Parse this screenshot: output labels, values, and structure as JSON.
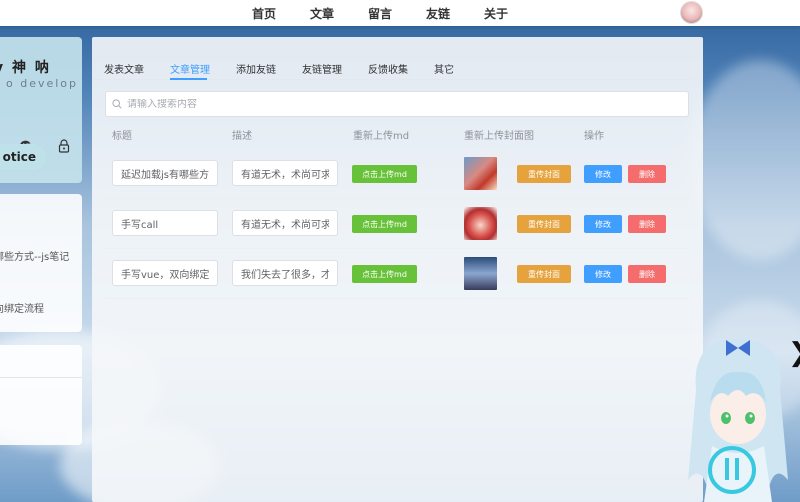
{
  "nav": {
    "links": [
      "首页",
      "文章",
      "留言",
      "友链",
      "关于"
    ]
  },
  "sidebar": {
    "name": "y 神 呐",
    "sub": "o develop",
    "notice": "otice",
    "recent": [
      "哪些方式--js笔记",
      "向绑定流程"
    ]
  },
  "tabs": [
    {
      "label": "发表文章",
      "active": false
    },
    {
      "label": "文章管理",
      "active": true
    },
    {
      "label": "添加友链",
      "active": false
    },
    {
      "label": "友链管理",
      "active": false
    },
    {
      "label": "反馈收集",
      "active": false
    },
    {
      "label": "其它",
      "active": false
    }
  ],
  "search": {
    "placeholder": "请输入搜索内容"
  },
  "table": {
    "headers": [
      "标题",
      "描述",
      "重新上传md",
      "重新上传封面图",
      "操作"
    ],
    "rows": [
      {
        "title": "延迟加载js有哪些方式--js笔记",
        "desc": "有道无术，术尚可求"
      },
      {
        "title": "手写call",
        "desc": "有道无术，术尚可求"
      },
      {
        "title": "手写vue，双向绑定流程",
        "desc": "我们失去了很多，才找到"
      }
    ],
    "upload_label": "点击上传md",
    "cover_label": "重传封面",
    "edit_label": "修改",
    "delete_label": "删除"
  },
  "colors": {
    "primary": "#409eff",
    "success": "#67c23a",
    "warning": "#e6a23c",
    "danger": "#f56c6c"
  },
  "icons": [
    "wechat-icon",
    "lock-icon",
    "search-icon",
    "power-icon"
  ]
}
